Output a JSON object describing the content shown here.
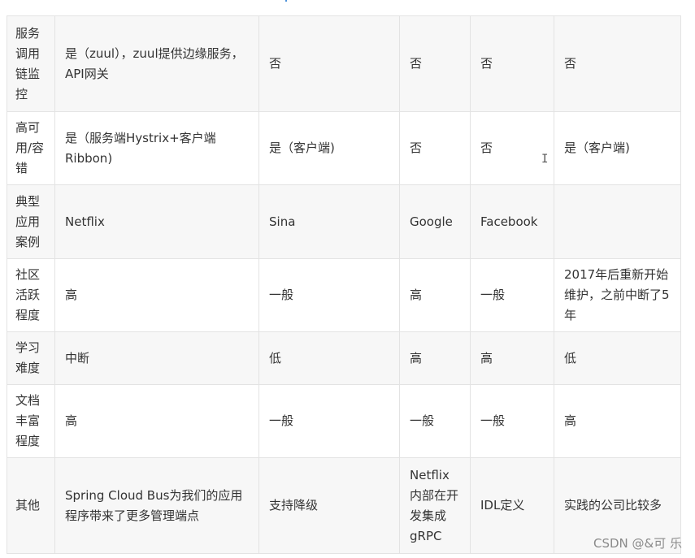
{
  "rows": [
    {
      "label": "服务调用链监控",
      "cells": [
        "是（zuul），zuul提供边缘服务，API网关",
        "否",
        "否",
        "否",
        "否"
      ]
    },
    {
      "label": "高可用/容错",
      "cells": [
        "是（服务端Hystrix+客户端Ribbon)",
        "是（客户端)",
        "否",
        "否",
        "是（客户端)"
      ]
    },
    {
      "label": "典型应用案例",
      "cells": [
        "Netflix",
        "Sina",
        "Google",
        "Facebook",
        ""
      ]
    },
    {
      "label": "社区活跃程度",
      "cells": [
        "高",
        "一般",
        "高",
        "一般",
        "2017年后重新开始维护，之前中断了5年"
      ]
    },
    {
      "label": "学习难度",
      "cells": [
        "中断",
        "低",
        "高",
        "高",
        "低"
      ]
    },
    {
      "label": "文档丰富程度",
      "cells": [
        "高",
        "一般",
        "一般",
        "一般",
        "高"
      ]
    },
    {
      "label": "其他",
      "cells": [
        "Spring Cloud Bus为我们的应用程序带来了更多管理端点",
        "支持降级",
        "Netflix内部在开发集成gRPC",
        "IDL定义",
        "实践的公司比较多"
      ]
    }
  ],
  "watermark": "CSDN @&可 乐"
}
